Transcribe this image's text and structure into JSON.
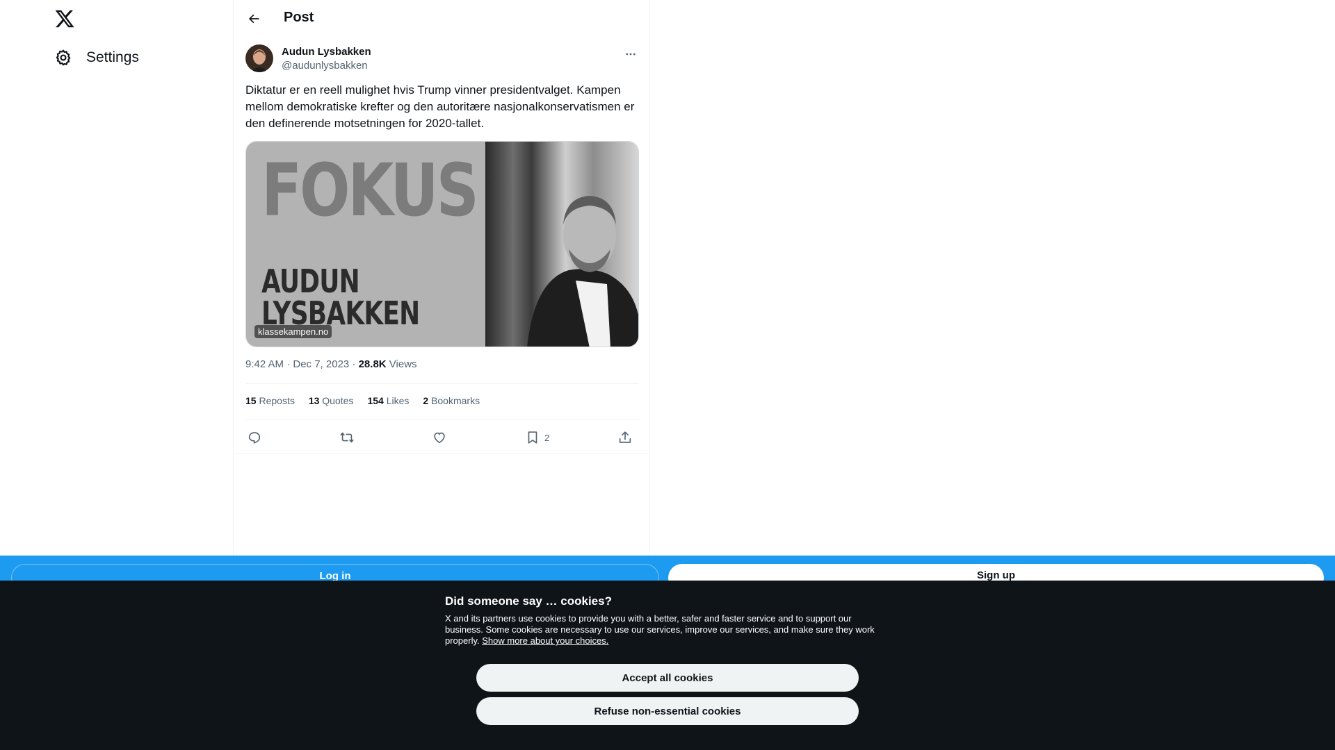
{
  "nav": {
    "logo_icon": "x-logo-icon",
    "settings_label": "Settings",
    "settings_icon": "gear-icon"
  },
  "header": {
    "title": "Post",
    "back_icon": "arrow-left-icon"
  },
  "post": {
    "author_name": "Audun Lysbakken",
    "author_handle": "@audunlysbakken",
    "text": "Diktatur er en reell mulighet hvis Trump vinner presidentvalget. Kampen mellom demokratiske krefter og den autoritære nasjonalkonservatismen er den definerende motsetningen for 2020-tallet.",
    "media": {
      "headline": "FOKUS",
      "name_line1": "AUDUN",
      "name_line2": "LYSBAKKEN",
      "source_badge": "klassekampen.no"
    },
    "time": "9:42 AM · Dec 7, 2023 · ",
    "views_count": "28.8K",
    "views_label": " Views",
    "stats": {
      "reposts_count": "15",
      "reposts_label": "Reposts",
      "quotes_count": "13",
      "quotes_label": "Quotes",
      "likes_count": "154",
      "likes_label": "Likes",
      "bookmarks_count": "2",
      "bookmarks_label": "Bookmarks"
    },
    "actions": {
      "bookmark_count": "2"
    }
  },
  "bottombar": {
    "login_label": "Log in",
    "signup_label": "Sign up",
    "color": "#1d9bf0"
  },
  "cookies": {
    "title": "Did someone say … cookies?",
    "text": "X and its partners use cookies to provide you with a better, safer and faster service and to support our business. Some cookies are necessary to use our services, improve our services, and make sure they work properly. ",
    "link": "Show more about your choices.",
    "accept_label": "Accept all cookies",
    "refuse_label": "Refuse non-essential cookies"
  }
}
